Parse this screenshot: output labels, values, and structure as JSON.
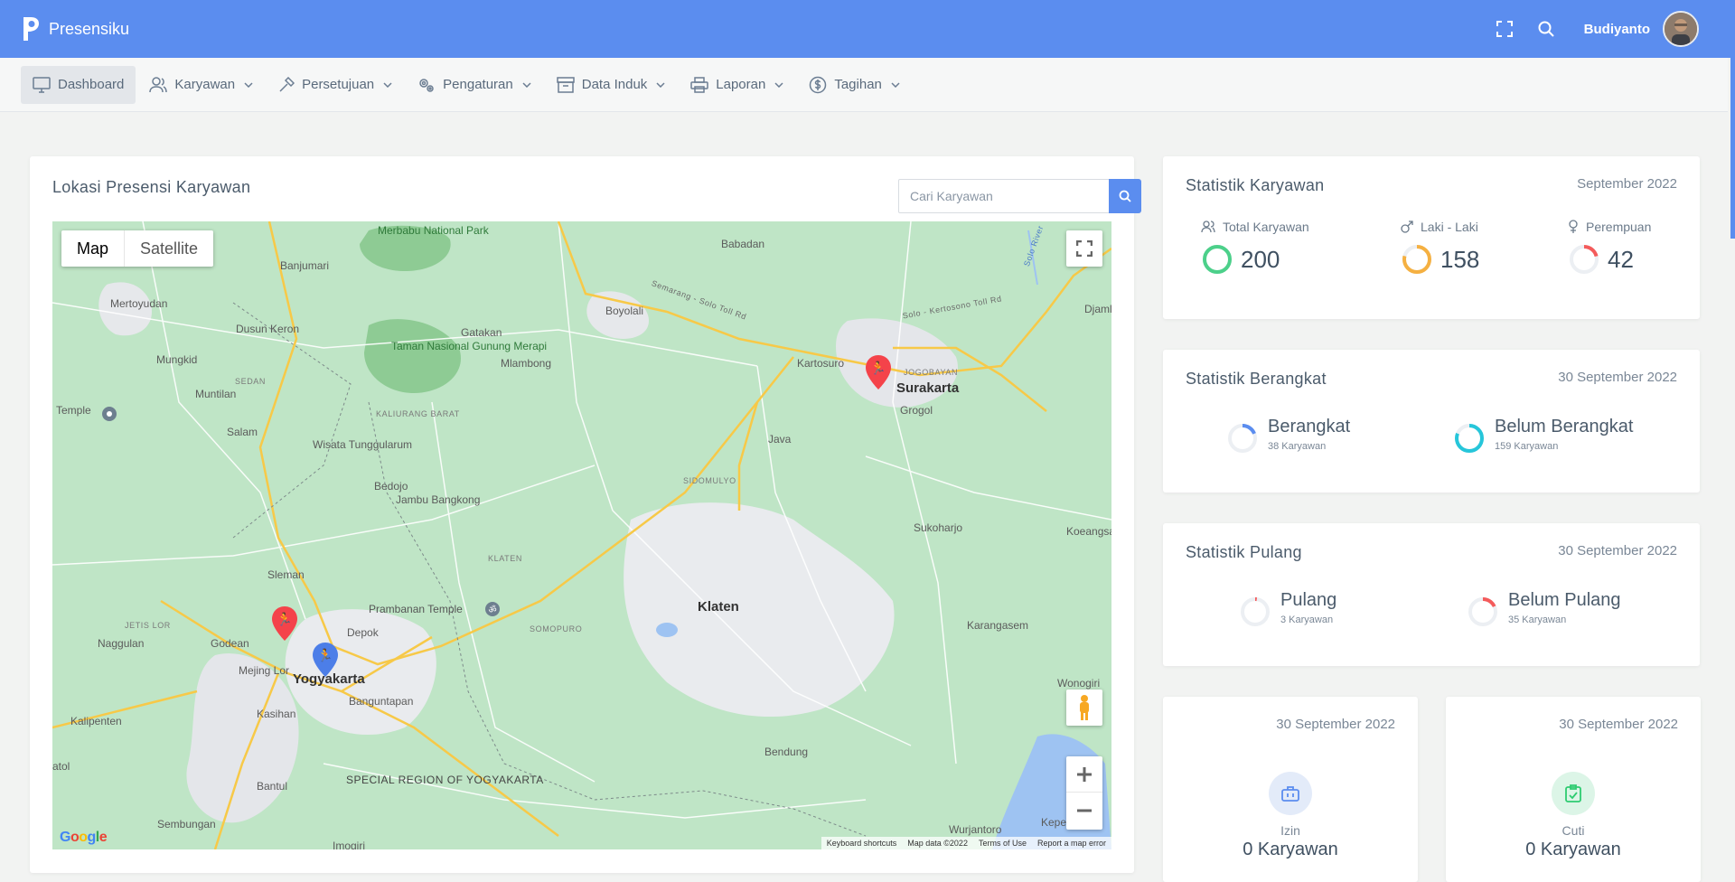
{
  "app": {
    "name": "Presensiku",
    "user_name": "Budiyanto"
  },
  "nav": {
    "items": [
      {
        "label": "Dashboard",
        "icon": "monitor-icon"
      },
      {
        "label": "Karyawan",
        "icon": "users-icon"
      },
      {
        "label": "Persetujuan",
        "icon": "hammer-icon"
      },
      {
        "label": "Pengaturan",
        "icon": "gears-icon"
      },
      {
        "label": "Data Induk",
        "icon": "archive-icon"
      },
      {
        "label": "Laporan",
        "icon": "printer-icon"
      },
      {
        "label": "Tagihan",
        "icon": "dollar-icon"
      }
    ]
  },
  "map_card": {
    "title": "Lokasi Presensi Karyawan",
    "search_placeholder": "Cari Karyawan",
    "map_type": [
      "Map",
      "Satellite"
    ],
    "footer": [
      "Keyboard shortcuts",
      "Map data ©2022",
      "Terms of Use",
      "Report a map error"
    ],
    "google": "Google",
    "labels": {
      "merbabu": "Merbabu National Park",
      "babadan": "Babadan",
      "banjumari": "Banjumari",
      "mertoyudan": "Mertoyudan",
      "boyolali": "Boyolali",
      "dusun_keron": "Dusun Keron",
      "gatakan": "Gatakan",
      "taman_merapi": "Taman Nasional Gunung Merapi",
      "mlambong": "Mlambong",
      "mungkid": "Mungkid",
      "sedan": "SEDAN",
      "muntilan": "Muntilan",
      "kartosuro": "Kartosuro",
      "jogobayan": "JOGOBAYAN",
      "surakarta": "Surakarta",
      "grogol": "Grogol",
      "temple": "Temple",
      "kaliurang": "KALIURANG BARAT",
      "salam": "Salam",
      "wisata": "Wisata Tunggularum",
      "java": "Java",
      "sidomulyo": "SIDOMULYO",
      "bedojo": "Bedojo",
      "jambu": "Jambu Bangkong",
      "sukoharjo": "Sukoharjo",
      "koeangsa": "Koeangsa",
      "klaten_small": "KLATEN",
      "sleman": "Sleman",
      "klaten": "Klaten",
      "prambanan": "Prambanan Temple",
      "jetis": "JETIS LOR",
      "depok": "Depok",
      "somopuro": "SOMOPURO",
      "nagulan": "Naggulan",
      "godean": "Godean",
      "karangasem": "Karangasem",
      "mejing": "Mejing Lor",
      "yogyakarta": "Yogyakarta",
      "wonogiri": "Wonogiri",
      "banguntapan": "Banguntapan",
      "kasihan": "Kasihan",
      "kalipenten": "Kalipenten",
      "bendung": "Bendung",
      "bantul": "Bantul",
      "diy": "SPECIAL REGION OF YOGYAKARTA",
      "sembungan": "Sembungan",
      "imogiri": "Imogiri",
      "wurjantoro": "Wurjantoro",
      "kepe": "Kepe",
      "djam": "Djaml",
      "solo_river": "Solo River",
      "toll1": "Semarang - Solo Toll Rd",
      "toll2": "Solo - Kertosono Toll Rd",
      "atol": "atol"
    }
  },
  "stats_karyawan": {
    "title": "Statistik Karyawan",
    "date": "September 2022",
    "metrics": [
      {
        "label": "Total Karyawan",
        "value": "200",
        "icon": "users-icon",
        "color": "#4cd08a",
        "fraction": 1.0
      },
      {
        "label": "Laki - Laki",
        "value": "158",
        "icon": "male-icon",
        "color": "#f5b041",
        "fraction": 0.79
      },
      {
        "label": "Perempuan",
        "value": "42",
        "icon": "female-icon",
        "color": "#f45b5b",
        "fraction": 0.21
      }
    ]
  },
  "stats_berangkat": {
    "title": "Statistik Berangkat",
    "date": "30 September 2022",
    "items": [
      {
        "title": "Berangkat",
        "note": "38 Karyawan",
        "color": "#5b8def",
        "fraction": 0.19
      },
      {
        "title": "Belum Berangkat",
        "note": "159 Karyawan",
        "color": "#26c6da",
        "fraction": 0.81
      }
    ]
  },
  "stats_pulang": {
    "title": "Statistik Pulang",
    "date": "30 September 2022",
    "items": [
      {
        "title": "Pulang",
        "note": "3 Karyawan",
        "color": "#f45b5b",
        "fraction": 0.02
      },
      {
        "title": "Belum Pulang",
        "note": "35 Karyawan",
        "color": "#f45b5b",
        "fraction": 0.18
      }
    ]
  },
  "izin": {
    "date": "30 September 2022",
    "label": "Izin",
    "value": "0 Karyawan",
    "icon": "briefcase-icon",
    "color": "#5b8def"
  },
  "cuti": {
    "date": "30 September 2022",
    "label": "Cuti",
    "value": "0 Karyawan",
    "icon": "clipboard-check-icon",
    "color": "#2ecc71"
  }
}
